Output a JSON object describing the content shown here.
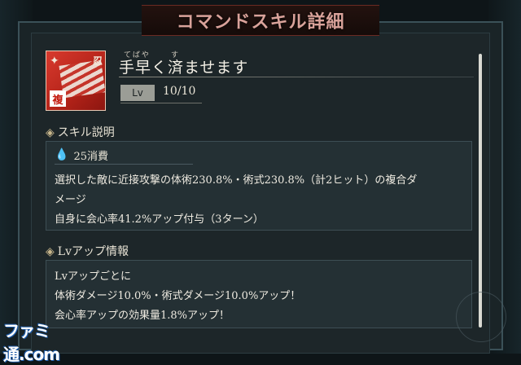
{
  "header": {
    "title": "コマンドスキル詳細"
  },
  "skill": {
    "name": "手早く済ませます",
    "ruby_1": "てばや",
    "ruby_2": "す",
    "lv_label": "Lv",
    "lv_value": "10/10",
    "icon_badge_top": "忍",
    "icon_badge_bottom": "複"
  },
  "description_section": {
    "heading": "スキル説明",
    "cost": "25消費",
    "lines": [
      "選択した敵に近接攻撃の体術230.8%・術式230.8%（計2ヒット）の複合ダ",
      "メージ",
      "自身に会心率41.2%アップ付与（3ターン）"
    ]
  },
  "lvup_section": {
    "heading": "Lvアップ情報",
    "lines": [
      "Lvアップごとに",
      "体術ダメージ10.0%・術式ダメージ10.0%アップ！",
      "会心率アップの効果量1.8%アップ！"
    ]
  },
  "watermark": {
    "text": "ファミ通.com"
  },
  "colors": {
    "accent_title": "#d9a29a",
    "icon_red": "#c41d12",
    "cost_drop": "#7cc4ea"
  }
}
